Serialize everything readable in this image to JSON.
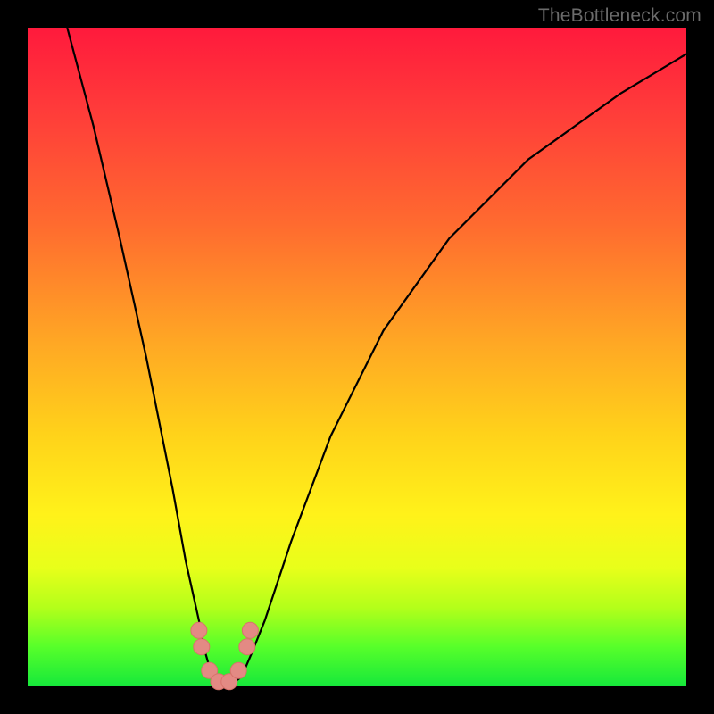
{
  "watermark": "TheBottleneck.com",
  "chart_data": {
    "type": "line",
    "title": "",
    "xlabel": "",
    "ylabel": "",
    "xlim": [
      0,
      100
    ],
    "ylim": [
      0,
      100
    ],
    "series": [
      {
        "name": "bottleneck-curve",
        "x": [
          6,
          10,
          14,
          18,
          22,
          24,
          26,
          27,
          28,
          29.5,
          31,
          32.5,
          34,
          36,
          40,
          46,
          54,
          64,
          76,
          90,
          100
        ],
        "y": [
          100,
          85,
          68,
          50,
          30,
          19,
          10,
          5,
          1.5,
          0.3,
          0.3,
          1.5,
          5,
          10,
          22,
          38,
          54,
          68,
          80,
          90,
          96
        ]
      }
    ],
    "markers": {
      "name": "highlight-dots",
      "x": [
        26.0,
        26.4,
        27.6,
        29.0,
        30.6,
        32.0,
        33.3,
        33.8
      ],
      "y": [
        8.5,
        6.0,
        2.4,
        0.7,
        0.7,
        2.4,
        6.0,
        8.5
      ]
    },
    "gradient_meaning": "background hue encodes severity (red=high bottleneck, green=optimal)",
    "colors": {
      "curve": "#000000",
      "markers": "#e38a84",
      "gradient_top": "#ff1a3c",
      "gradient_bottom": "#16e83b"
    }
  }
}
